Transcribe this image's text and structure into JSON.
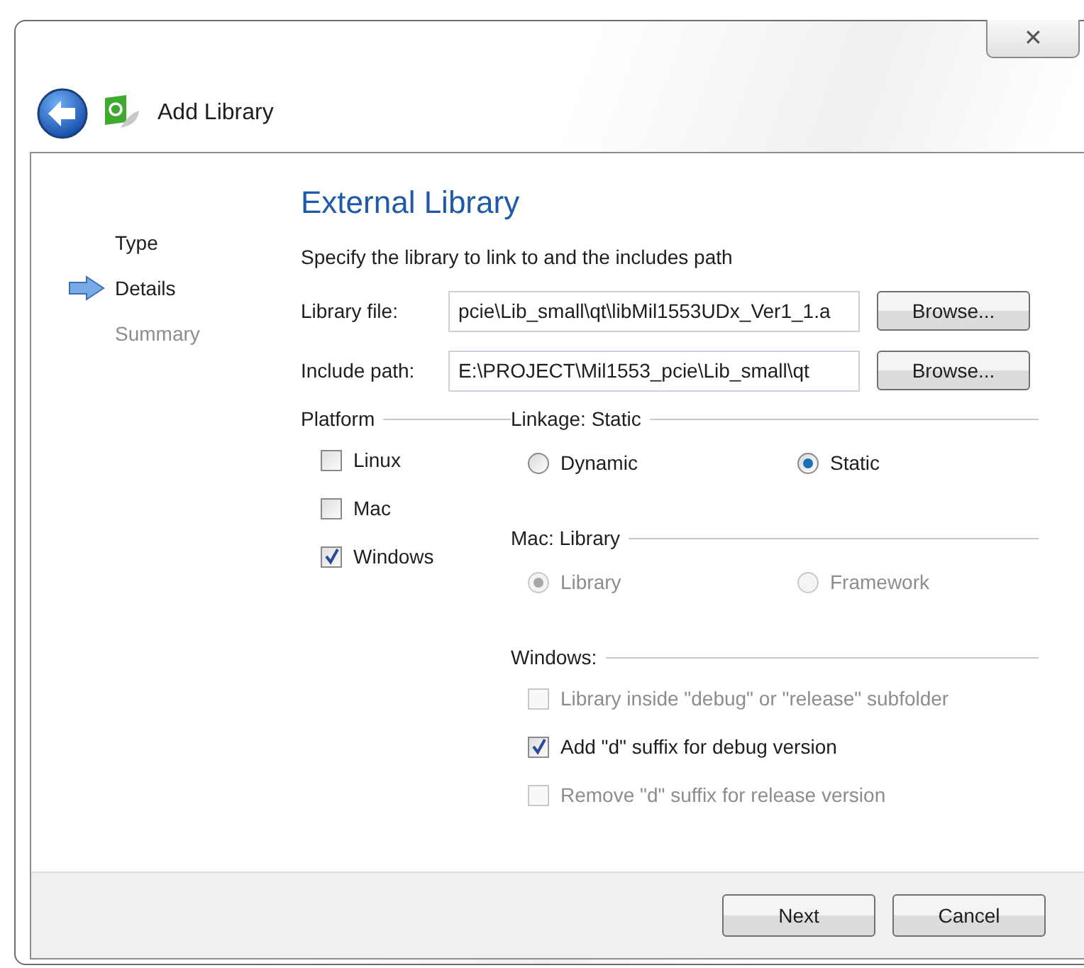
{
  "window": {
    "title": "Add Library",
    "close_label": "✕"
  },
  "steps": [
    {
      "label": "Type",
      "selected": false,
      "disabled": false
    },
    {
      "label": "Details",
      "selected": true,
      "disabled": false
    },
    {
      "label": "Summary",
      "selected": false,
      "disabled": true
    }
  ],
  "page": {
    "title": "External Library",
    "description": "Specify the library to link to and the includes path"
  },
  "fields": [
    {
      "label": "Library file:",
      "value": "pcie\\Lib_small\\qt\\libMil1553UDx_Ver1_1.a",
      "button": "Browse..."
    },
    {
      "label": "Include path:",
      "value": "E:\\PROJECT\\Mil1553_pcie\\Lib_small\\qt",
      "button": "Browse..."
    }
  ],
  "platform": {
    "title": "Platform",
    "options": [
      {
        "label": "Linux",
        "checked": false
      },
      {
        "label": "Mac",
        "checked": false
      },
      {
        "label": "Windows",
        "checked": true
      }
    ]
  },
  "linkage": {
    "title": "Linkage: Static",
    "options": [
      {
        "label": "Dynamic",
        "selected": false,
        "disabled": false
      },
      {
        "label": "Static",
        "selected": true,
        "disabled": false
      }
    ]
  },
  "mac": {
    "title": "Mac: Library",
    "options": [
      {
        "label": "Library",
        "selected": true,
        "disabled": true
      },
      {
        "label": "Framework",
        "selected": false,
        "disabled": true
      }
    ]
  },
  "windows": {
    "title": "Windows:",
    "options": [
      {
        "label": "Library inside \"debug\" or \"release\" subfolder",
        "checked": false,
        "disabled": true
      },
      {
        "label": "Add \"d\" suffix for debug version",
        "checked": true,
        "disabled": false
      },
      {
        "label": "Remove \"d\" suffix for release version",
        "checked": false,
        "disabled": true
      }
    ]
  },
  "buttons": [
    "Next",
    "Cancel"
  ]
}
